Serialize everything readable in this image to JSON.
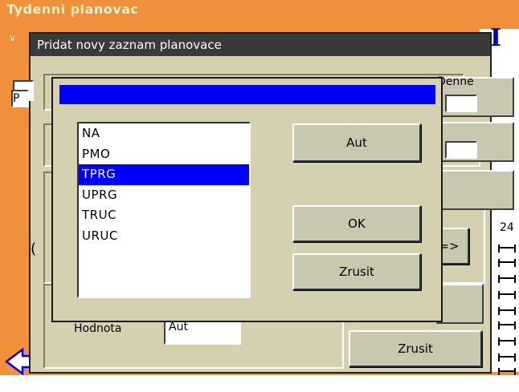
{
  "background_window": {
    "title": "Tydenni planovac",
    "subtitle_char": "v",
    "i_glyph": "I",
    "col_letter": "P",
    "scale_label": "24",
    "daily_label": "Denne",
    "hodnota_label": "Hodnota",
    "hodnota_value": "Aut",
    "zrusit_label": "Zrusit",
    "next_label": "=>",
    "left_glyph": "("
  },
  "middle_dialog": {
    "title": "Pridat novy zaznam planovace"
  },
  "front_dialog": {
    "title": "",
    "list": {
      "items": [
        "NA",
        "PMO",
        "TPRG",
        "UPRG",
        "TRUC",
        "URUC"
      ],
      "selected_index": 2
    },
    "buttons": {
      "aut": "Aut",
      "ok": "OK",
      "zrusit": "Zrusit"
    }
  },
  "colors": {
    "background_accent": "#f0903a",
    "dialog_face": "#d4d0b0",
    "selection": "#0000ff",
    "title_dark": "#3a3a3a"
  }
}
